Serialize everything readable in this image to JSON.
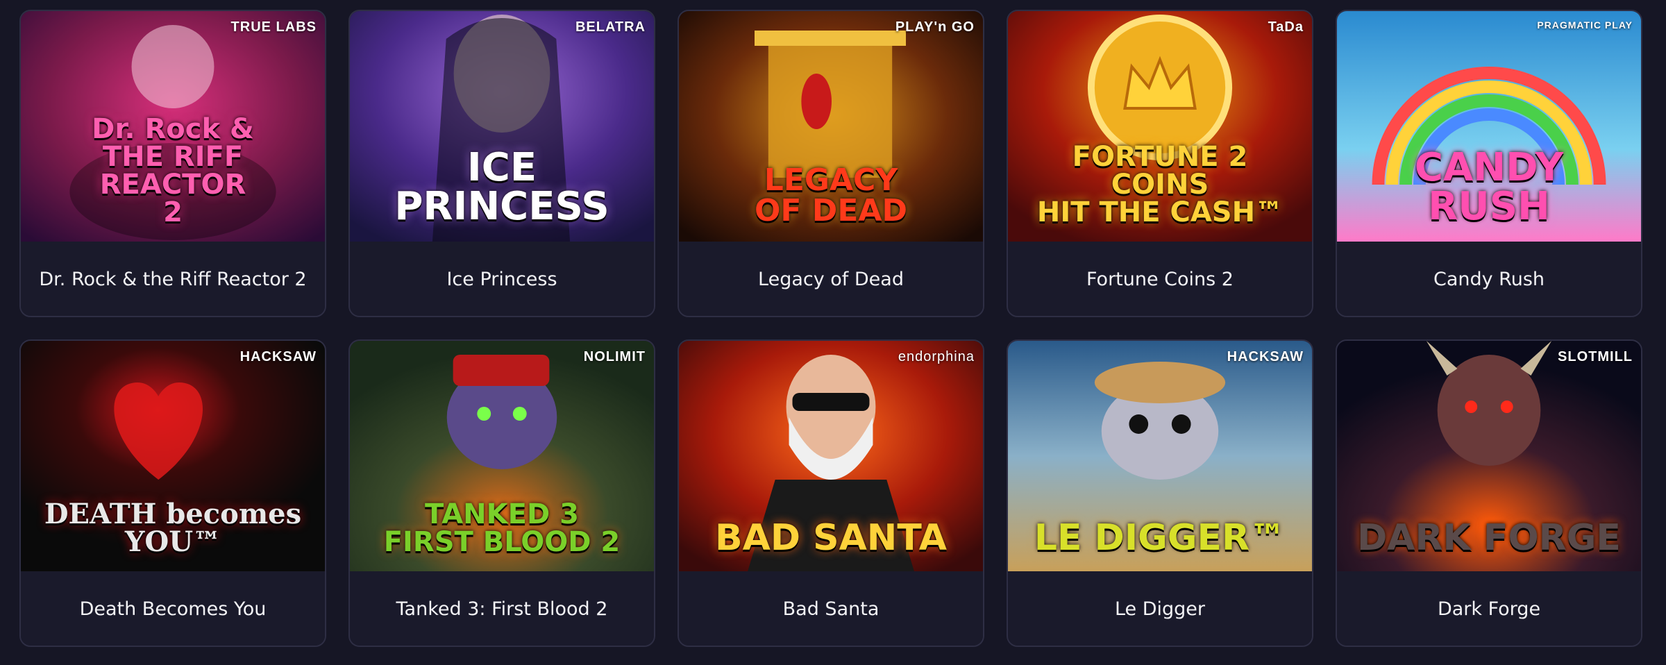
{
  "games": [
    {
      "name": "Dr. Rock & the Riff Reactor 2",
      "provider": "TRUE LABS",
      "art_title": "Dr. Rock &\nTHE RIFF\nREACTOR\n2",
      "colors": [
        "#2a0b36",
        "#7a1a4a",
        "#d62f7a"
      ],
      "title_color": "#ff5fb0"
    },
    {
      "name": "Ice Princess",
      "provider": "BELATRA",
      "art_title": "ICE\nPRINCESS",
      "colors": [
        "#1a1540",
        "#4a2a8a",
        "#9b6ad6"
      ],
      "title_color": "#ffffff"
    },
    {
      "name": "Legacy of Dead",
      "provider": "PLAY'n GO",
      "art_title": "LEGACY\nOF DEAD",
      "colors": [
        "#1a0a05",
        "#6a2a0a",
        "#d8901a"
      ],
      "title_color": "#ff3a1a"
    },
    {
      "name": "Fortune Coins 2",
      "provider": "TaDa",
      "art_title": "FORTUNE 2\nCOINS\nHIT THE CASH™",
      "colors": [
        "#4a0a0a",
        "#a81a0a",
        "#f0a010"
      ],
      "title_color": "#ffd23a"
    },
    {
      "name": "Candy Rush",
      "provider": "PRAGMATIC PLAY",
      "art_title": "CANDY\nRUSH",
      "colors": [
        "#2a8ad0",
        "#7ad0f0",
        "#ff7ac8"
      ],
      "title_color": "#ff4fb0"
    },
    {
      "name": "Death Becomes You",
      "provider": "HACKSAW",
      "art_title": "DEATH becomes YOU™",
      "colors": [
        "#0a0a0a",
        "#3a0a0a",
        "#c8141a"
      ],
      "title_color": "#e8e8e8"
    },
    {
      "name": "Tanked 3: First Blood 2",
      "provider": "NOLIMIT",
      "art_title": "TANKED 3\nFIRST BLOOD 2",
      "colors": [
        "#1a2a1a",
        "#3a4a2a",
        "#d86a1a"
      ],
      "title_color": "#7ad02a"
    },
    {
      "name": "Bad Santa",
      "provider": "endorphina",
      "art_title": "BAD SANTA",
      "colors": [
        "#3a0a0a",
        "#a81a0a",
        "#ff6a1a"
      ],
      "title_color": "#ffd23a"
    },
    {
      "name": "Le Digger",
      "provider": "HACKSAW",
      "art_title": "LE DIGGER™",
      "colors": [
        "#2a5a8a",
        "#8ab0c8",
        "#c8a05a"
      ],
      "title_color": "#d8e02a"
    },
    {
      "name": "Dark Forge",
      "provider": "SLOTMILL",
      "art_title": "DARK FORGE",
      "colors": [
        "#0a0a1a",
        "#3a1a2a",
        "#ff5a0a"
      ],
      "title_color": "#5a4a4a"
    }
  ]
}
